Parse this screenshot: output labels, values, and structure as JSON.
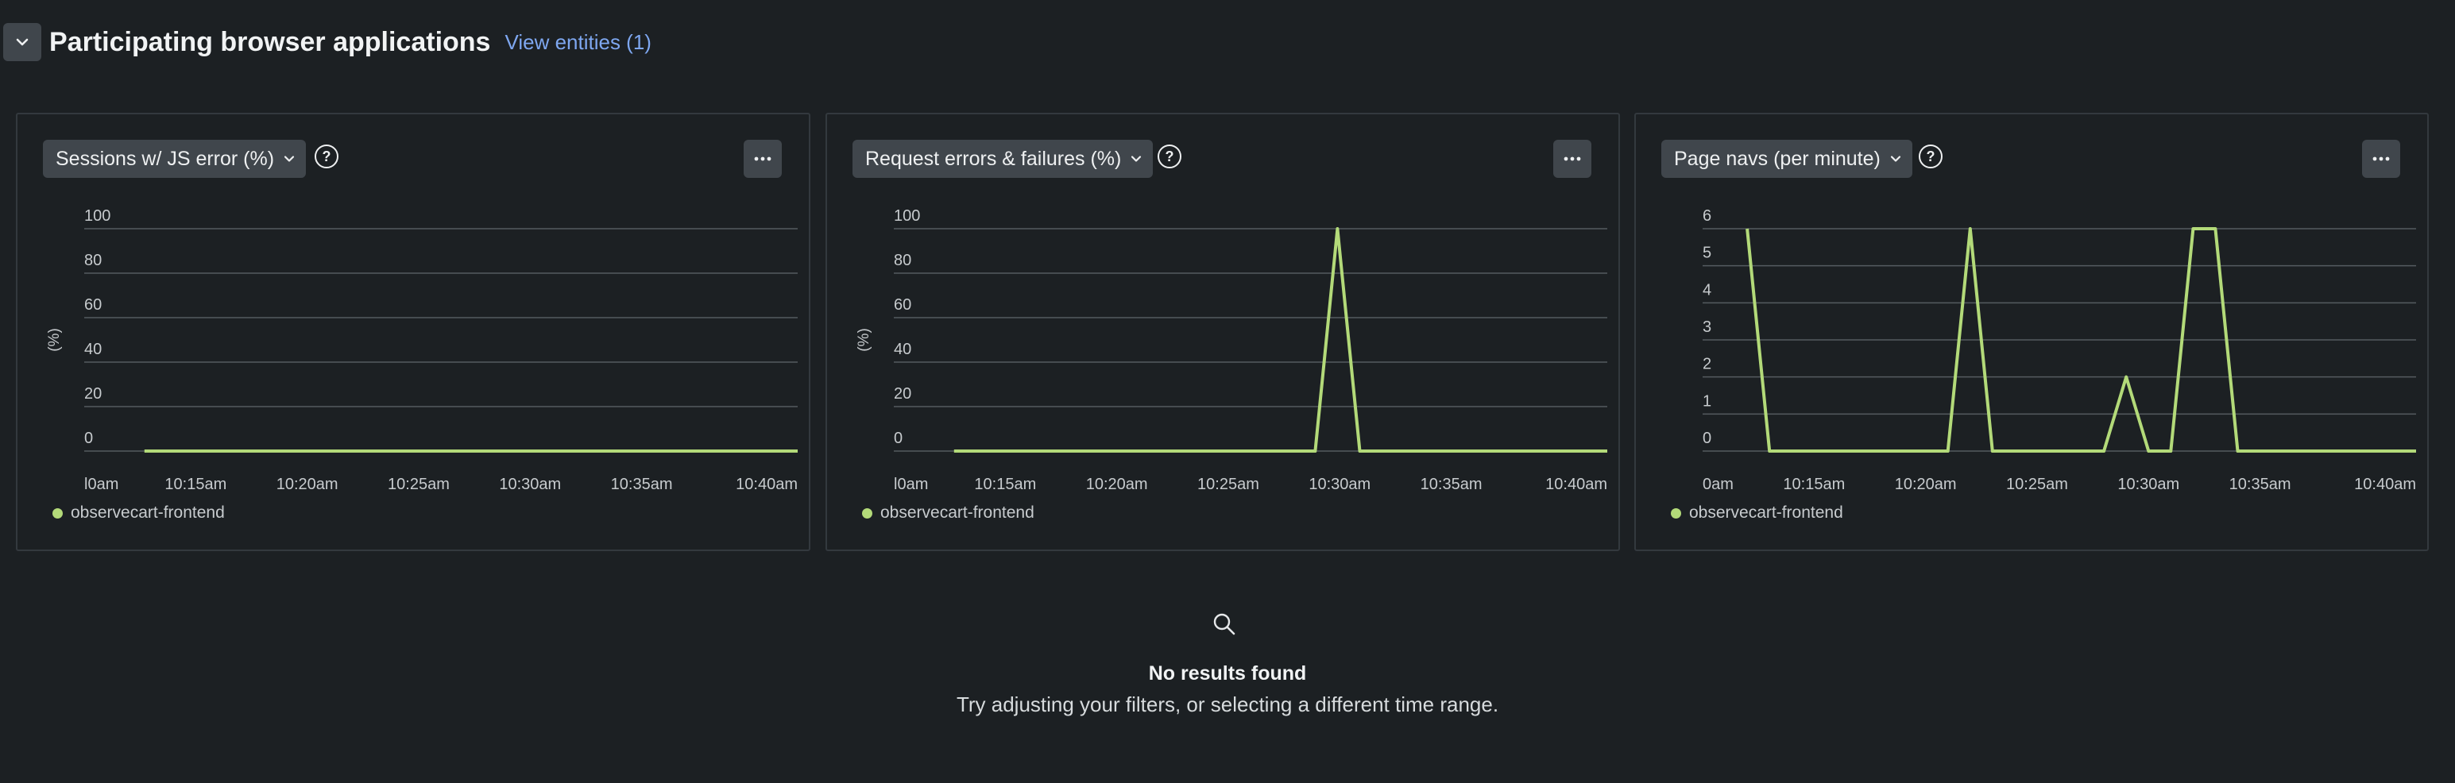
{
  "section": {
    "title": "Participating browser applications",
    "view_link": "View entities (1)"
  },
  "cards": [
    {
      "metric_label": "Sessions w/ JS error (%)",
      "chart_data": {
        "type": "line",
        "ylabel": "(%)",
        "y_ticks": [
          "0",
          "20",
          "40",
          "60",
          "80",
          "100"
        ],
        "ylim": [
          0,
          100
        ],
        "x_ticks": [
          "l0am",
          "10:15am",
          "10:20am",
          "10:25am",
          "10:30am",
          "10:35am",
          "10:40am"
        ],
        "x_minutes": [
          10,
          15,
          20,
          25,
          30,
          35,
          40
        ],
        "xlim": [
          10,
          42
        ],
        "series": [
          {
            "name": "observecart-frontend",
            "color": "#b3da79",
            "x": [
              12.7,
              42
            ],
            "y": [
              0,
              0
            ]
          }
        ]
      }
    },
    {
      "metric_label": "Request errors & failures (%)",
      "chart_data": {
        "type": "line",
        "ylabel": "(%)",
        "y_ticks": [
          "0",
          "20",
          "40",
          "60",
          "80",
          "100"
        ],
        "ylim": [
          0,
          100
        ],
        "x_ticks": [
          "l0am",
          "10:15am",
          "10:20am",
          "10:25am",
          "10:30am",
          "10:35am",
          "10:40am"
        ],
        "x_minutes": [
          10,
          15,
          20,
          25,
          30,
          35,
          40
        ],
        "xlim": [
          10,
          42
        ],
        "series": [
          {
            "name": "observecart-frontend",
            "color": "#b3da79",
            "x": [
              12.7,
              28.9,
              29.9,
              30.9,
              42
            ],
            "y": [
              0,
              0,
              100,
              0,
              0
            ]
          }
        ]
      }
    },
    {
      "metric_label": "Page navs (per minute)",
      "chart_data": {
        "type": "line",
        "ylabel": "",
        "y_ticks": [
          "0",
          "1",
          "2",
          "3",
          "4",
          "5",
          "6"
        ],
        "ylim": [
          0,
          6
        ],
        "x_ticks": [
          "0am",
          "10:15am",
          "10:20am",
          "10:25am",
          "10:30am",
          "10:35am",
          "10:40am"
        ],
        "x_minutes": [
          10,
          15,
          20,
          25,
          30,
          35,
          40
        ],
        "xlim": [
          10,
          42
        ],
        "series": [
          {
            "name": "observecart-frontend",
            "color": "#b3da79",
            "x": [
              12,
              13,
              21,
              22,
              23,
              28,
              29,
              30,
              31,
              32,
              33,
              34,
              35,
              42
            ],
            "y": [
              6,
              0,
              0,
              6,
              0,
              0,
              2,
              0,
              0,
              6,
              6,
              0,
              0,
              0
            ]
          }
        ]
      }
    }
  ],
  "empty_state": {
    "title": "No results found",
    "subtitle": "Try adjusting your filters, or selecting a different time range.",
    "icon": "search-icon"
  }
}
